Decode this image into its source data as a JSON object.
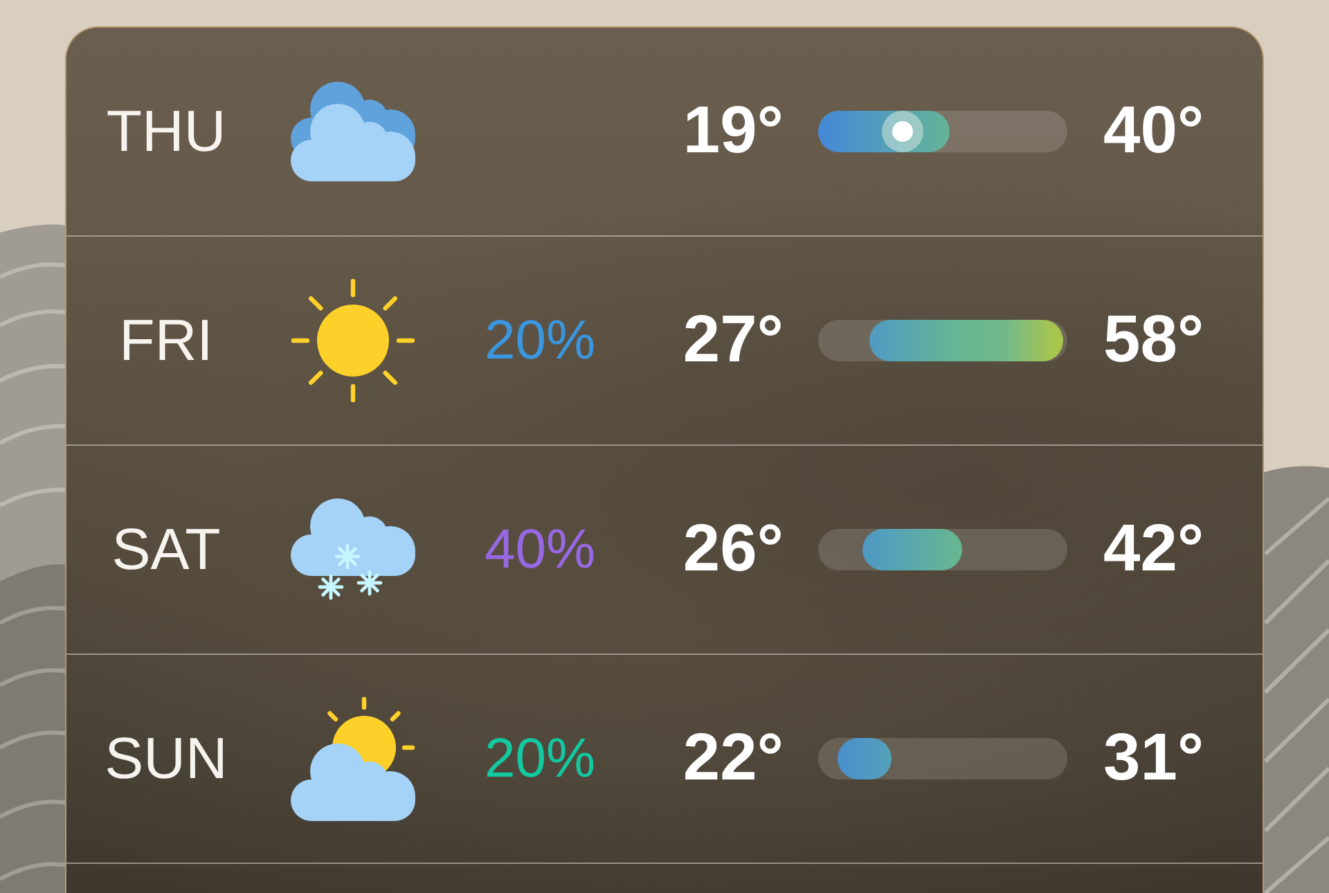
{
  "forecast": [
    {
      "day": "THU",
      "kind": "cloudy",
      "low": "19°",
      "high": "40°",
      "range_bar": {
        "level": 0.53
      },
      "current": {
        "level": 0.34
      }
    },
    {
      "day": "FRI",
      "kind": "sunny",
      "precipitation": {
        "text": "20%",
        "color": "#3a96de"
      },
      "low": "27°",
      "high": "58°",
      "range_bar": {
        "level": 0.78
      }
    },
    {
      "day": "SAT",
      "kind": "snow",
      "precipitation": {
        "text": "40%",
        "color": "#9868e4"
      },
      "low": "26°",
      "high": "42°",
      "range_bar": {
        "level": 0.4
      }
    },
    {
      "day": "SUN",
      "kind": "partly_cloudy",
      "precipitation": {
        "text": "20%",
        "color": "#12c9a2"
      },
      "low": "22°",
      "high": "31°",
      "range_bar": {
        "level": 0.22
      }
    }
  ]
}
